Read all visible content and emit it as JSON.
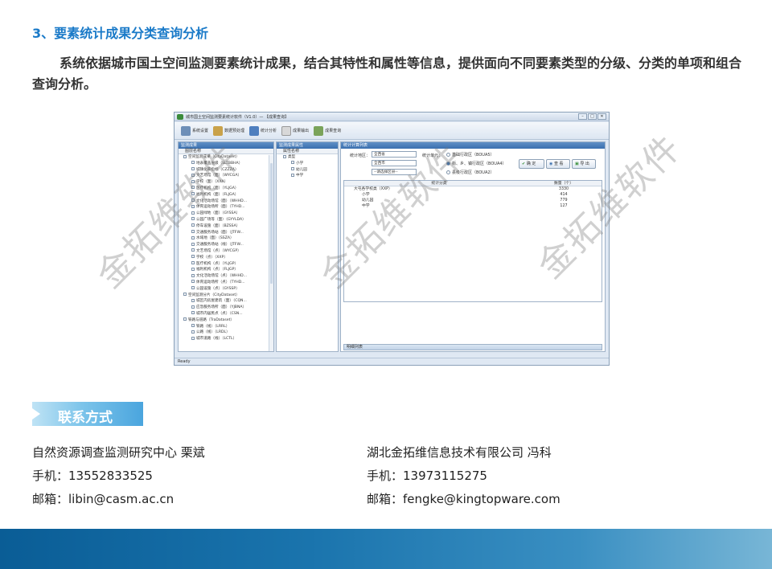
{
  "section_title": "3、要素统计成果分类查询分析",
  "paragraph": "系统依据城市国土空间监测要素统计成果，结合其特性和属性等信息，提供面向不同要素类型的分级、分类的单项和组合查询分析。",
  "app": {
    "title": "城市国土空间监测要素统计软件（V1.0）— 【成果查询】",
    "window_buttons": [
      "–",
      "□",
      "✕"
    ],
    "toolbar": [
      "系统设置",
      "数据预处理",
      "统计分析",
      "成果输出",
      "成果查询"
    ],
    "left_pane": {
      "header": "监测成果",
      "column": "图层名称",
      "rows": [
        "空间监测成果（CityDataset）",
        "地表覆盖层级（SLTBBHA）",
        "城镇化率指标（CZZZA）",
        "文艺场馆（面）（WYCGA）",
        "学校（面）（XXA）",
        "医疗机构（面）（YLJGA）",
        "福利机构（面）（FLJGA）",
        "文化活动场馆（面）（WHHD...",
        "体育运动场所（面）（TYHD...",
        "公园绿地（面）（GYSSA）",
        "公园广场等（面）（GYYLDA）",
        "停车设施（面）（BZSSA）",
        "交通服务场站（面）（JTFW...",
        "水域地（面）（SSZA）",
        "交通服务场站（线）（JTFW...",
        "文艺场馆（点）（WYCGP）",
        "学校（点）（XXP）",
        "医疗机构（点）（YLJGP）",
        "福利机构（点）（FLJGP）",
        "文化活动场馆（点）（WHHD...",
        "体育运动场所（点）（TYHD...",
        "公园设施（点）（GYSSP）",
        "空间监测分片（CityDataset）",
        "城区内房屋建筑（面）（CQN...",
        "应急服务场所（面）（YJBNA）",
        "城市内居民点（点）（CSN...",
        "铁路与道路（TraDataset）",
        "铁路（线）（LRRL）",
        "公路（线）（LRDL）",
        "城市道路（线）（LCTL）"
      ]
    },
    "middle_pane": {
      "header": "监测成果属性",
      "column": "属性名称",
      "rows": [
        "类型",
        "小学",
        "幼儿园",
        "中学"
      ]
    },
    "right_pane": {
      "header": "统计计算列表",
      "stat_region_label": "统计地区：",
      "selects": [
        "全西省",
        "全西市",
        "--请选择区县--"
      ],
      "stat_unit_label": "统计单元：",
      "radios": [
        "基础行政区（BOUA5）",
        "街、乡、镇行政区（BOUA4）",
        "县级行政区（BOUA2）"
      ],
      "buttons": [
        "确 定",
        "查 看",
        "导 出"
      ],
      "grid_headers": [
        "统计分类",
        "数量（个）"
      ],
      "grid_rows": [
        {
          "name": "大屯各学校类（XXP）",
          "count": "3330"
        },
        {
          "name": "小学",
          "count": "414"
        },
        {
          "name": "幼儿园",
          "count": "779"
        },
        {
          "name": "中学",
          "count": "127"
        }
      ],
      "detail_bar": "明细列表"
    },
    "status": "Ready"
  },
  "watermark": "金拓维软件",
  "contact_heading": "联系方式",
  "contacts": [
    {
      "org_name": "自然资源调查监测研究中心 栗斌",
      "phone": "手机：13552833525",
      "email": "邮箱：libin@casm.ac.cn"
    },
    {
      "org_name": "湖北金拓维信息技术有限公司 冯科",
      "phone": "手机：13973115275",
      "email": "邮箱：fengke@kingtopware.com"
    }
  ],
  "colors": {
    "accent": "#1a7ac8",
    "footer": "#1a74ad"
  }
}
